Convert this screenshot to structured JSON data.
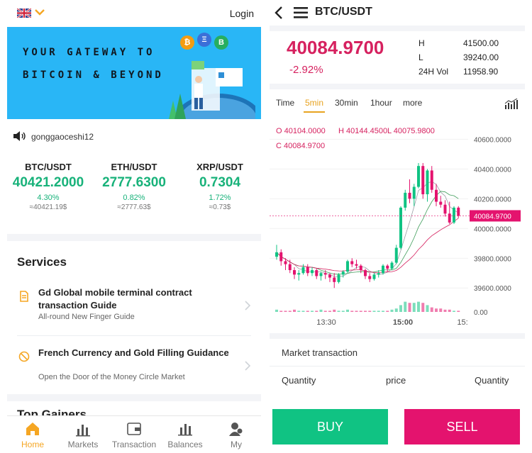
{
  "left": {
    "topbar": {
      "login_label": "Login"
    },
    "banner": {
      "line1": "YOUR GATEWAY TO",
      "line2": "BITCOIN & BEYOND",
      "coins": [
        "₿",
        "Ξ",
        "B"
      ]
    },
    "notice": {
      "text": "gonggaoceshi12"
    },
    "tickers": [
      {
        "pair": "BTC/USDT",
        "price": "40421.2000",
        "change": "4.30%",
        "approx": "≈40421.19$"
      },
      {
        "pair": "ETH/USDT",
        "price": "2777.6300",
        "change": "0.82%",
        "approx": "≈2777.63$"
      },
      {
        "pair": "XRP/USDT",
        "price": "0.7304",
        "change": "1.72%",
        "approx": "≈0.73$"
      }
    ],
    "services": {
      "title": "Services",
      "items": [
        {
          "title": "Gd Global mobile terminal contract transaction Guide",
          "subtitle": "All-round New Finger Guide"
        },
        {
          "title": "French Currency and Gold Filling Guidance",
          "subtitle": "Open the Door of the Money Circle Market"
        }
      ]
    },
    "gainers_title": "Top Gainers",
    "tabs": [
      {
        "label": "Home",
        "icon": "home-icon"
      },
      {
        "label": "Markets",
        "icon": "markets-icon"
      },
      {
        "label": "Transaction",
        "icon": "wallet-icon"
      },
      {
        "label": "Balances",
        "icon": "balances-icon"
      },
      {
        "label": "My",
        "icon": "user-icon"
      }
    ]
  },
  "right": {
    "header": {
      "pair": "BTC/USDT"
    },
    "price": {
      "last": "40084.9700",
      "change": "-2.92%"
    },
    "stats": [
      {
        "label": "H",
        "value": "41500.00"
      },
      {
        "label": "L",
        "value": "39240.00"
      },
      {
        "label": "24H Vol",
        "value": "11958.90"
      }
    ],
    "timeframes": [
      "Time",
      "5min",
      "30min",
      "1hour",
      "more"
    ],
    "active_timeframe": "5min",
    "ohlc": {
      "o": "O 40104.0000",
      "h": "H 40144.4500",
      "l": "L 40075.9800",
      "c": "C 40084.9700"
    },
    "market": {
      "title": "Market transaction",
      "columns": [
        "Quantity",
        "price",
        "Quantity"
      ]
    },
    "buy_label": "BUY",
    "sell_label": "SELL"
  },
  "colors": {
    "up": "#10c383",
    "down": "#e4136e",
    "accent": "#f5a623",
    "price_red": "#d6215f"
  },
  "chart_data": {
    "type": "candlestick",
    "y_ticks": [
      "40600.0000",
      "40400.0000",
      "40200.0000",
      "40000.0000",
      "39800.0000",
      "39600.0000"
    ],
    "x_ticks": [
      "13:30",
      "15:00",
      "15:"
    ],
    "volume_label": "0.00",
    "last_price_label": "40084.9700",
    "ylim": [
      39520,
      40640
    ],
    "candles": [
      [
        39810,
        39890,
        39790,
        39840
      ],
      [
        39840,
        39860,
        39750,
        39780
      ],
      [
        39780,
        39800,
        39720,
        39760
      ],
      [
        39760,
        39790,
        39700,
        39720
      ],
      [
        39720,
        39740,
        39660,
        39690
      ],
      [
        39690,
        39720,
        39650,
        39700
      ],
      [
        39700,
        39760,
        39690,
        39740
      ],
      [
        39740,
        39760,
        39680,
        39700
      ],
      [
        39700,
        39740,
        39680,
        39720
      ],
      [
        39720,
        39730,
        39660,
        39680
      ],
      [
        39680,
        39710,
        39650,
        39700
      ],
      [
        39700,
        39720,
        39660,
        39690
      ],
      [
        39690,
        39700,
        39640,
        39670
      ],
      [
        39670,
        39700,
        39600,
        39640
      ],
      [
        39640,
        39700,
        39630,
        39690
      ],
      [
        39690,
        39720,
        39670,
        39710
      ],
      [
        39710,
        39790,
        39700,
        39780
      ],
      [
        39780,
        39800,
        39740,
        39760
      ],
      [
        39760,
        39790,
        39730,
        39750
      ],
      [
        39750,
        39760,
        39700,
        39720
      ],
      [
        39720,
        39730,
        39660,
        39680
      ],
      [
        39680,
        39700,
        39640,
        39660
      ],
      [
        39660,
        39700,
        39650,
        39690
      ],
      [
        39690,
        39720,
        39670,
        39700
      ],
      [
        39700,
        39760,
        39690,
        39750
      ],
      [
        39750,
        39760,
        39710,
        39730
      ],
      [
        39730,
        39780,
        39720,
        39770
      ],
      [
        39770,
        39890,
        39760,
        39870
      ],
      [
        39870,
        40150,
        39860,
        40140
      ],
      [
        40140,
        40260,
        40120,
        40240
      ],
      [
        40240,
        40330,
        40170,
        40200
      ],
      [
        40200,
        40300,
        40150,
        40280
      ],
      [
        40280,
        40440,
        40270,
        40420
      ],
      [
        40420,
        40440,
        40200,
        40230
      ],
      [
        40230,
        40400,
        40180,
        40390
      ],
      [
        40390,
        40420,
        40240,
        40260
      ],
      [
        40260,
        40300,
        40150,
        40180
      ],
      [
        40180,
        40220,
        40140,
        40160
      ],
      [
        40160,
        40190,
        40080,
        40100
      ],
      [
        40100,
        40180,
        40030,
        40040
      ],
      [
        40040,
        40150,
        40030,
        40140
      ],
      [
        40140,
        40150,
        40070,
        40085
      ]
    ],
    "volumes": [
      2,
      1,
      1,
      1,
      2,
      1,
      1,
      1,
      1,
      1,
      2,
      1,
      1,
      2,
      1,
      1,
      2,
      1,
      1,
      1,
      1,
      1,
      1,
      1,
      1,
      1,
      2,
      3,
      6,
      9,
      8,
      8,
      9,
      8,
      6,
      4,
      3,
      3,
      2,
      2,
      1,
      1
    ]
  }
}
